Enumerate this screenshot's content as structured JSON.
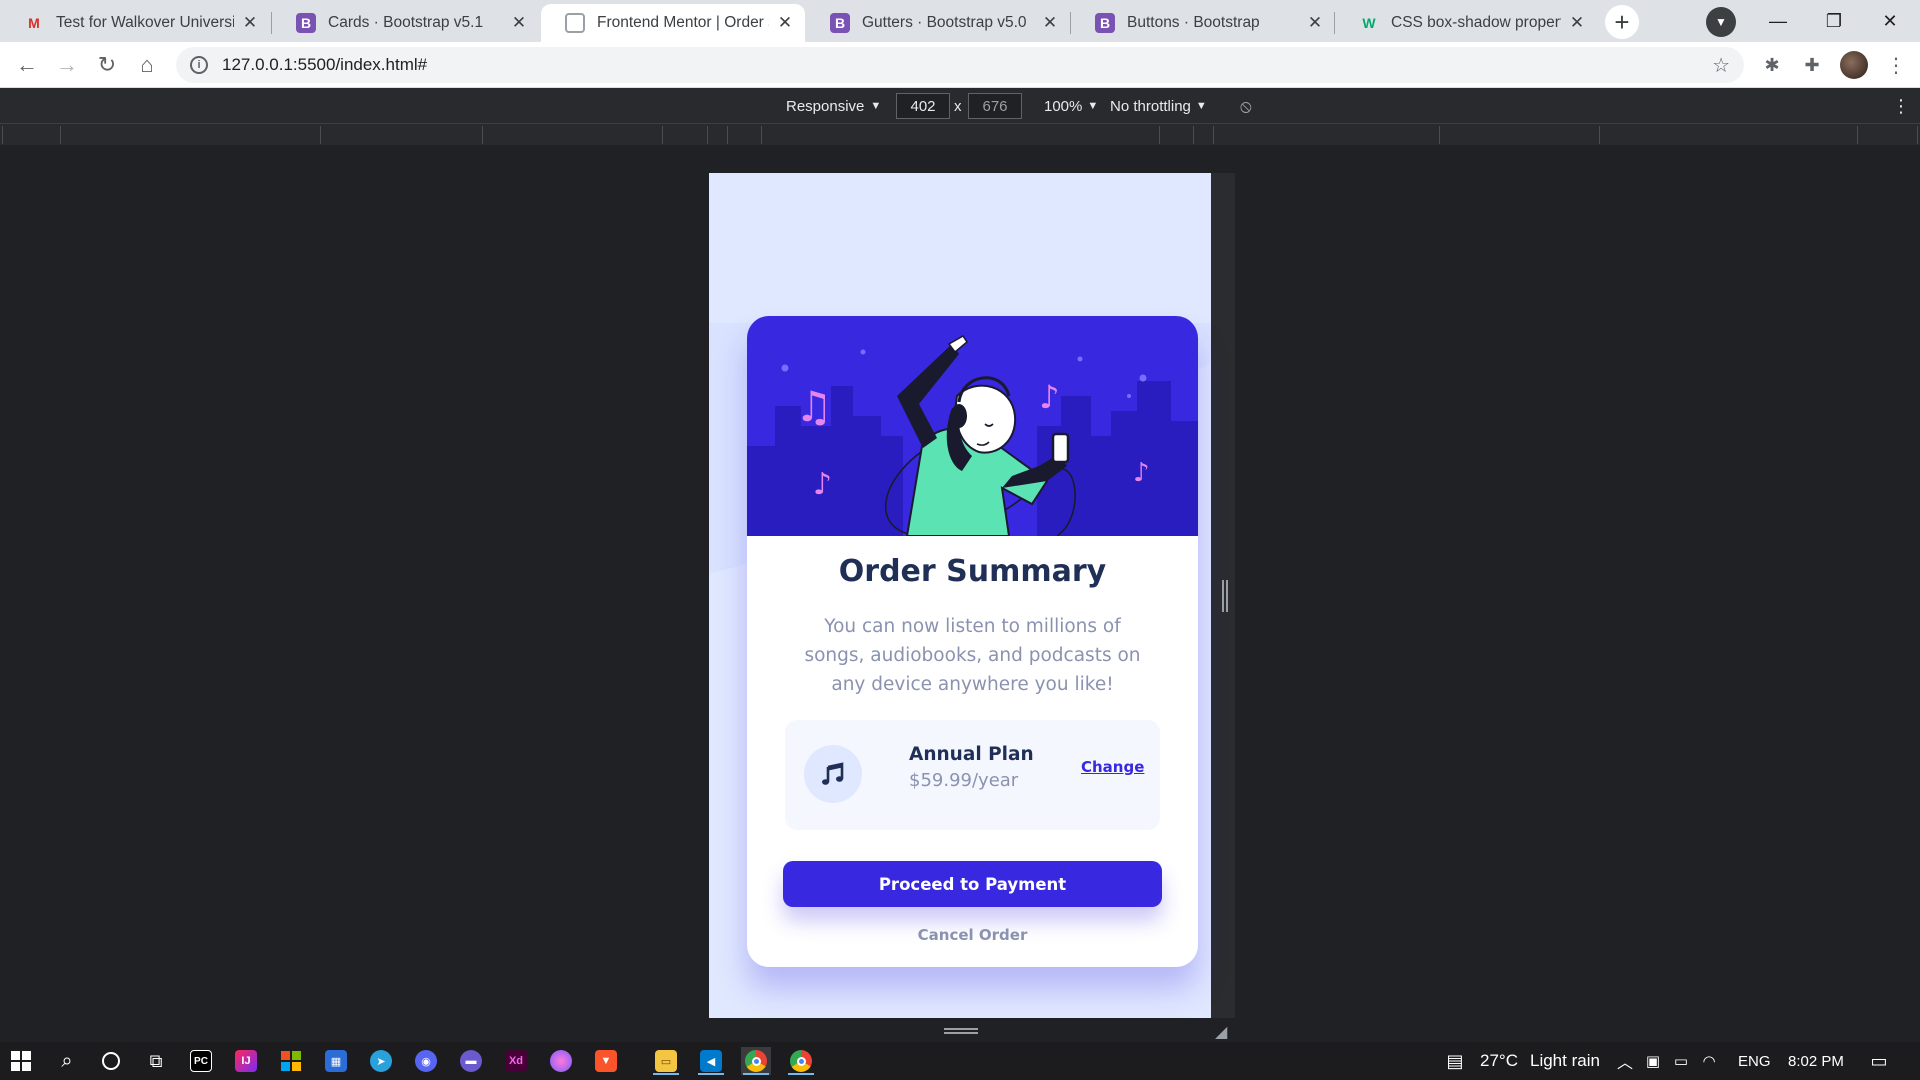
{
  "browser": {
    "tabs": [
      {
        "title": "Test for Walkover University",
        "favicon": "gmail-icon",
        "active": false
      },
      {
        "title": "Cards · Bootstrap v5.1",
        "favicon": "bootstrap-icon",
        "active": false
      },
      {
        "title": "Frontend Mentor | Order su",
        "favicon": "loading-icon",
        "active": true
      },
      {
        "title": "Gutters · Bootstrap v5.0",
        "favicon": "bootstrap-icon",
        "active": false
      },
      {
        "title": "Buttons · Bootstrap",
        "favicon": "bootstrap-icon",
        "active": false
      },
      {
        "title": "CSS box-shadow property",
        "favicon": "w3schools-icon",
        "active": false
      }
    ],
    "url": "127.0.0.1:5500/index.html#"
  },
  "devtools": {
    "device_mode": "Responsive",
    "width_value": "402",
    "height_value": "676",
    "dim_separator": "x",
    "zoom": "100%",
    "throttling": "No throttling"
  },
  "order_card": {
    "title": "Order Summary",
    "description": "You can now listen to millions of songs, audiobooks, and podcasts on any device anywhere you like!",
    "plan_name": "Annual Plan",
    "plan_price": "$59.99/year",
    "change_label": "Change",
    "pay_label": "Proceed to Payment",
    "cancel_label": "Cancel Order"
  },
  "taskbar": {
    "weather_temp": "27°C",
    "weather_text": "Light rain",
    "language": "ENG",
    "time": "8:02 PM"
  },
  "colors": {
    "brand_blue": "#3828e0",
    "pale_blue": "#e0e8ff",
    "dark_navy": "#1f2f56",
    "desaturated_blue": "#8a92b0"
  }
}
